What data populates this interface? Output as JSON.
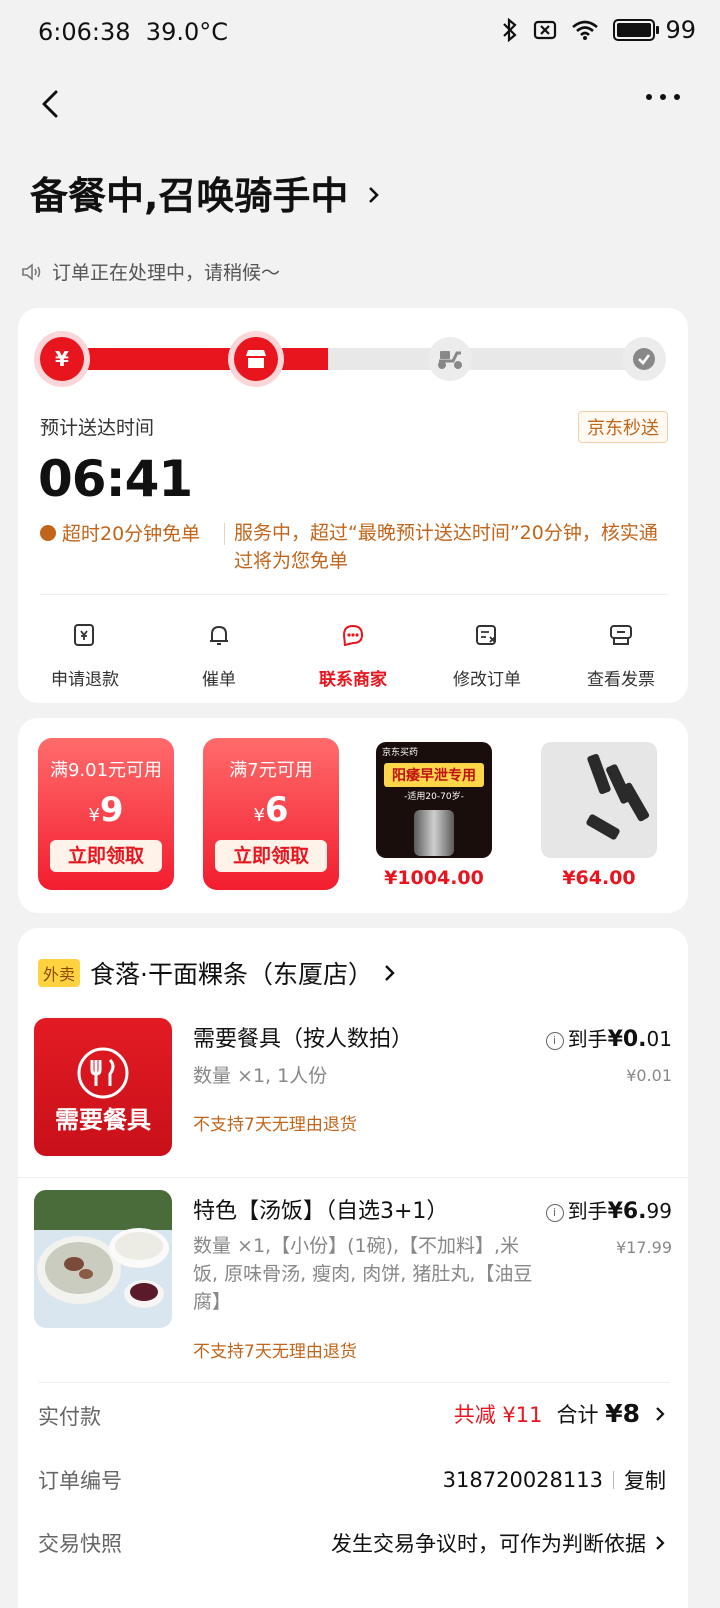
{
  "status_bar": {
    "time": "6:06:38",
    "temperature": "39.0°C",
    "battery": "99"
  },
  "header": {
    "back_icon": "back-arrow-icon",
    "more_icon": "more-dots-icon"
  },
  "order_status": {
    "title": "备餐中,召唤骑手中",
    "notice": "订单正在处理中，请稍候～"
  },
  "progress": {
    "steps": [
      "paid",
      "merchant",
      "rider",
      "delivered"
    ],
    "fraction": 0.5
  },
  "delivery": {
    "eta_label": "预计送达时间",
    "eta_time": "06:41",
    "badge": "京东秒送",
    "free_tag": "超时20分钟免单",
    "free_desc": "服务中，超过“最晚预计送达时间”20分钟，核实通过将为您免单"
  },
  "actions": [
    {
      "label": "申请退款",
      "icon": "refund-icon"
    },
    {
      "label": "催单",
      "icon": "bell-icon"
    },
    {
      "label": "联系商家",
      "icon": "chat-icon"
    },
    {
      "label": "修改订单",
      "icon": "edit-order-icon"
    },
    {
      "label": "查看发票",
      "icon": "invoice-icon"
    }
  ],
  "coupons": [
    {
      "condition": "满9.01元可用",
      "currency": "¥",
      "amount": "9",
      "button": "立即领取"
    },
    {
      "condition": "满7元可用",
      "currency": "¥",
      "amount": "6",
      "button": "立即领取"
    }
  ],
  "promo_products": [
    {
      "price": "¥1004.00",
      "image_text": "阳痿早泄专用",
      "image_sub": "-适用20-70岁-",
      "image_brand": "京东买药"
    },
    {
      "price": "¥64.00"
    }
  ],
  "shop": {
    "tag": "外卖",
    "name": "食落·干面粿条（东厦店）"
  },
  "items": [
    {
      "name": "需要餐具（按人数拍）",
      "spec": "数量 ×1, 1人份",
      "warn": "不支持7天无理由退货",
      "pay_label": "到手",
      "pay_currency": "¥",
      "pay_main": "0.",
      "pay_cents": "01",
      "original": "¥0.01",
      "image_text": "需要餐具"
    },
    {
      "name": "特色【汤饭】（自选3+1）",
      "spec": "数量 ×1,【小份】(1碗),【不加料】,米饭, 原味骨汤, 瘦肉, 肉饼, 猪肚丸,【油豆腐】",
      "warn": "不支持7天无理由退货",
      "pay_label": "到手",
      "pay_currency": "¥",
      "pay_main": "6.",
      "pay_cents": "99",
      "original": "¥17.99"
    }
  ],
  "summary": {
    "paid_label": "实付款",
    "discount": "共减 ¥11",
    "total_label": "合计",
    "total": "¥8",
    "order_no_label": "订单编号",
    "order_no": "318720028113",
    "copy": "复制",
    "snapshot_label": "交易快照",
    "snapshot_text": "发生交易争议时，可作为判断依据"
  }
}
